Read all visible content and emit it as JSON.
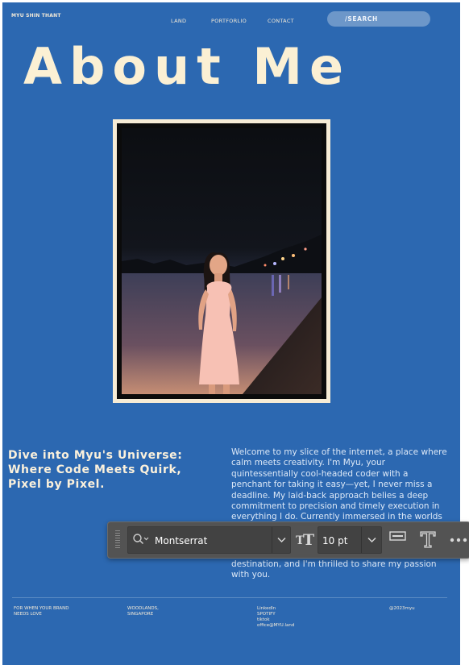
{
  "header": {
    "brand": "MYU SHIN THANT",
    "nav": [
      "LAND",
      "PORTFORLIO",
      "CONTACT"
    ],
    "search_label": "/SEARCH"
  },
  "hero": {
    "title": "About Me"
  },
  "about": {
    "tagline": "Dive into Myu's Universe: Where Code Meets Quirk, Pixel by Pixel.",
    "body": "Welcome to my slice of the internet, a place where calm meets creativity. I'm Myu, your quintessentially cool-headed coder with a penchant for taking it easy—yet, I never miss a deadline. My laid-back approach belies a deep commitment to precision and timely execution in everything I do. Currently immersed in the worlds of web design, VR, and programming, I am constantly learning",
    "closing": "destination, and I'm thrilled to share my passion with you."
  },
  "footer": {
    "col1": [
      "FOR WHEN YOUR BRAND",
      "NEEDS LOVE"
    ],
    "col2": [
      "WOODLANDS,",
      "SINGAPORE"
    ],
    "col3": [
      "LinkedIn",
      "SPOTIFY",
      "tiktok",
      "office@MYU.land"
    ],
    "col4": "@2023myu"
  },
  "toolbar": {
    "font_family": "Montserrat",
    "font_size": "10 pt"
  },
  "colors": {
    "page_bg": "#2c68b1",
    "cream": "#fbf0d4",
    "toolbar_bg": "#535353"
  }
}
